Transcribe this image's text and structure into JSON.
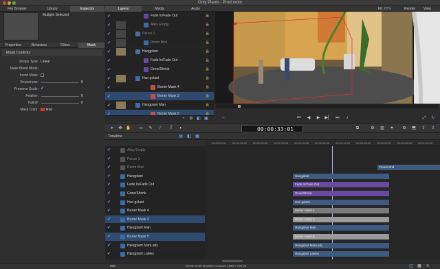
{
  "window": {
    "title": "Only Plants - Prod.motn"
  },
  "left_tabs": [
    "File Browser",
    "Library",
    "Inspector"
  ],
  "preview": {
    "caption": "Multiple Selected"
  },
  "inspector_tabs": [
    "Properties",
    "Behaviors",
    "Filters",
    "Mask"
  ],
  "mask_controls": {
    "heading": "Mask Controls",
    "shape_type_label": "Shape Type:",
    "shape_type_value": "Linear",
    "blend_mode_label": "Mask Blend Mode:",
    "blend_mode_value": "",
    "invert_label": "Invert Mask:",
    "roundness_label": "Roundness:",
    "roundness_value": "0",
    "preserve_scale_label": "Preserve Scale:",
    "feather_label": "Feather:",
    "feather_value": "0",
    "falloff_label": "Falloff:",
    "falloff_value": "0",
    "color_label": "Mask Color:",
    "color_value": "Red"
  },
  "layer_tabs": [
    "Layers",
    "Media",
    "Audio"
  ],
  "layers": [
    {
      "name": "Fade In/Fade Out",
      "indent": 56,
      "type": "behavior"
    },
    {
      "name": "Alley Empty",
      "indent": 56,
      "type": "clip",
      "dim": true
    },
    {
      "name": "Pence 1",
      "indent": 44,
      "type": "group",
      "dim": true
    },
    {
      "name": "Room Bnd",
      "indent": 56,
      "type": "clip",
      "dim": true
    },
    {
      "name": "Hangplant",
      "indent": 44,
      "type": "group"
    },
    {
      "name": "Fade In/Fade Out",
      "indent": 56,
      "type": "behavior"
    },
    {
      "name": "Grow/Shrink",
      "indent": 56,
      "type": "behavior"
    },
    {
      "name": "Han golant",
      "indent": 44,
      "type": "clip"
    },
    {
      "name": "Bezier Mask 4",
      "indent": 66,
      "type": "mask"
    },
    {
      "name": "Bezier Mask 3",
      "indent": 66,
      "type": "mask",
      "sel": true
    },
    {
      "name": "Hangplant Man",
      "indent": 44,
      "type": "clip"
    },
    {
      "name": "Bezier Mask 5",
      "indent": 66,
      "type": "mask",
      "sel": true
    }
  ],
  "canvas": {
    "fit_label": "Fit:",
    "fit_value": "87%",
    "render_label": "Render",
    "view_label": "View"
  },
  "timecode": "00:00:33:01",
  "timeline": {
    "label": "Timeline",
    "ruler": [
      "00:00:20:00",
      "00:00:24:00",
      "00:00:28:00",
      "00:00:32:00",
      "00:00:36:00",
      "00:00:40:00",
      "00:00:44:00",
      "00:00:48:00",
      "00:00:52:00",
      "00:00:56:00",
      "00:01:00:00"
    ],
    "tracks": [
      {
        "name": "Alley Empty",
        "dim": true
      },
      {
        "name": "Pence 1",
        "dim": true
      },
      {
        "name": "Room Bnd",
        "dim": true
      },
      {
        "name": "Hangplant"
      },
      {
        "name": "Fade In/Fade Out"
      },
      {
        "name": "Grow/Shrink"
      },
      {
        "name": "Han golant"
      },
      {
        "name": "Bezier Mask 4"
      },
      {
        "name": "Bezier Mask 3",
        "sel": true
      },
      {
        "name": "Hangplant Man"
      },
      {
        "name": "Bezier Mask 5",
        "sel": true
      },
      {
        "name": "Hangplant ManLady"
      },
      {
        "name": "Hangplant Lables"
      }
    ],
    "clips": [
      {
        "track": 2,
        "label": "Room Bnd",
        "color": "#3f5a80"
      },
      {
        "track": 3,
        "label": "Hangplant",
        "color": "#3f5a80"
      },
      {
        "track": 4,
        "label": "Fade In/Fade Out",
        "color": "#6a4aa0"
      },
      {
        "track": 5,
        "label": "Grow/Shrink",
        "color": "#6a4aa0"
      },
      {
        "track": 6,
        "label": "Han golant",
        "color": "#3f5a80"
      },
      {
        "track": 7,
        "label": "Bezier Mask 4",
        "color": "#7a7a7a"
      },
      {
        "track": 8,
        "label": "Bezier Mask 3",
        "color": "#9a9a9a"
      },
      {
        "track": 9,
        "label": "Hangplant Man",
        "color": "#3f5a80"
      },
      {
        "track": 10,
        "label": "Bezier Mask 5",
        "color": "#9a9a9a"
      },
      {
        "track": 11,
        "label": "Hangplant ManLady",
        "color": "#3f5a80"
      },
      {
        "track": 12,
        "label": "Hangplant Lables",
        "color": "#3f5a80"
      }
    ],
    "mini_label": "Mini"
  },
  "status": "00:00:10:00 Duration Custom 1280 x 720 24"
}
